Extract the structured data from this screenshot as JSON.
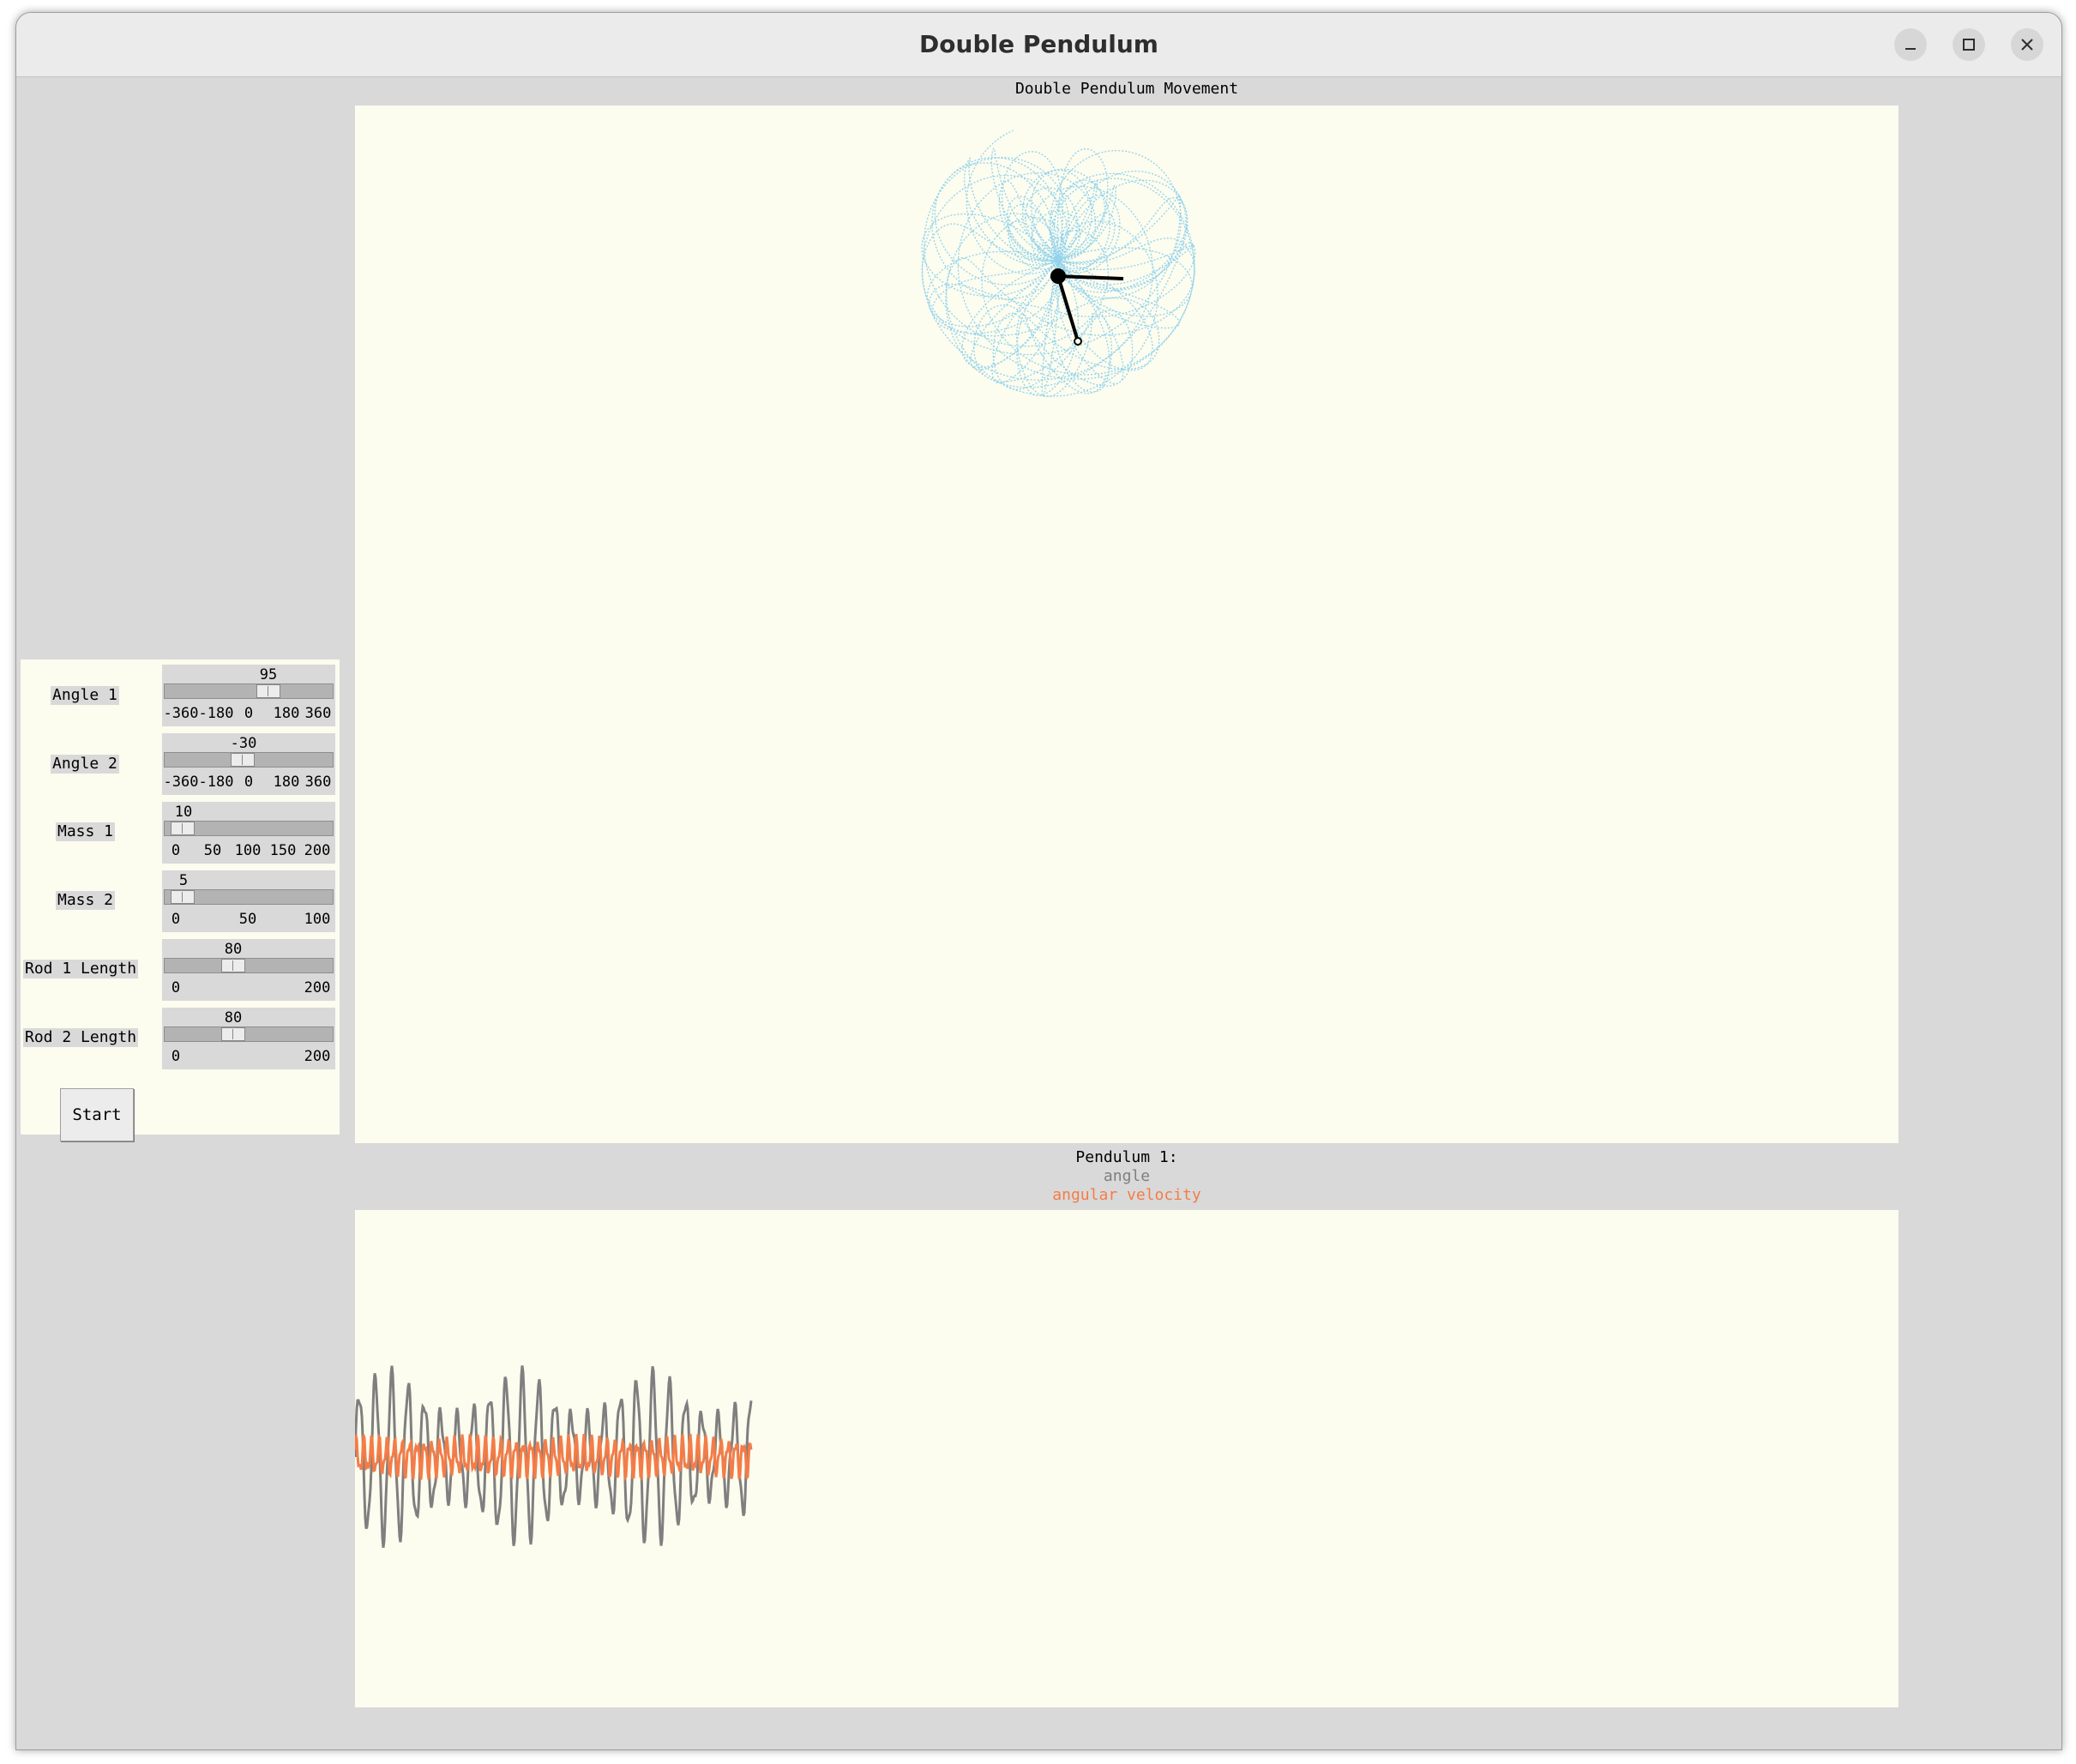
{
  "window": {
    "title": "Double Pendulum",
    "controls": [
      "minimize-icon",
      "maximize-icon",
      "close-icon"
    ]
  },
  "animation": {
    "caption": "Double Pendulum Movement",
    "trace_color": "#87ceeb",
    "rod_color": "#000000"
  },
  "controls": {
    "angle1": {
      "label": "Angle 1",
      "value": "95",
      "ticks": [
        "-360",
        "-180",
        "0",
        "180",
        "360"
      ]
    },
    "angle2": {
      "label": "Angle 2",
      "value": "-30",
      "ticks": [
        "-360",
        "-180",
        "0",
        "180",
        "360"
      ]
    },
    "mass1": {
      "label": "Mass 1",
      "value": "10",
      "ticks": [
        "0",
        "50",
        "100",
        "150",
        "200"
      ]
    },
    "mass2": {
      "label": "Mass 2",
      "value": "5",
      "ticks": [
        "0",
        "50",
        "100"
      ]
    },
    "rod1": {
      "label": "Rod 1 Length",
      "value": "80",
      "ticks": [
        "0",
        "200"
      ]
    },
    "rod2": {
      "label": "Rod 2 Length",
      "value": "80",
      "ticks": [
        "0",
        "200"
      ]
    },
    "start_label": "Start"
  },
  "plot": {
    "title": "Pendulum 1:",
    "legend": [
      {
        "name": "angle",
        "color": "#7f7f7f"
      },
      {
        "name": "angular velocity",
        "color": "#f47c48"
      }
    ]
  }
}
